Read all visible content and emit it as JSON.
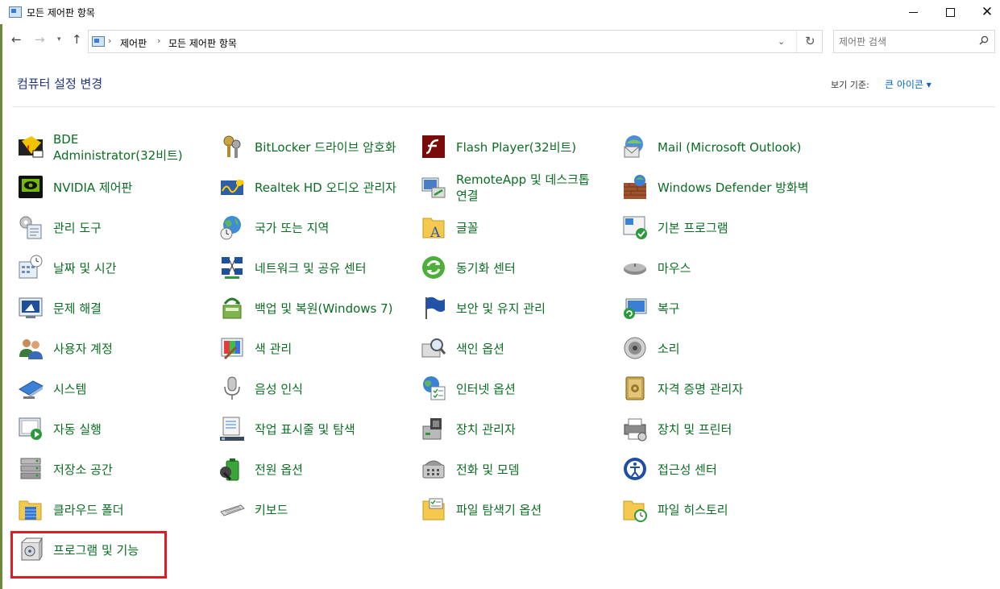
{
  "window": {
    "title": "모든 제어판 항목",
    "icon": "control-panel-icon"
  },
  "nav": {
    "back_icon": "back-arrow-icon",
    "forward_icon": "forward-arrow-icon",
    "recent_icon": "chevron-down-icon",
    "up_icon": "up-arrow-icon"
  },
  "address": {
    "breadcrumbs": [
      "제어판",
      "모든 제어판 항목"
    ]
  },
  "search": {
    "placeholder": "제어판 검색"
  },
  "header": {
    "title": "컴퓨터 설정 변경",
    "view_by_label": "보기 기준:",
    "view_by_value": "큰 아이콘 ▾"
  },
  "items": [
    {
      "label": "BDE Administrator(32비트)",
      "icon": "bde-admin-icon"
    },
    {
      "label": "BitLocker 드라이브 암호화",
      "icon": "bitlocker-icon"
    },
    {
      "label": "Flash Player(32비트)",
      "icon": "flash-player-icon"
    },
    {
      "label": "Mail (Microsoft Outlook)",
      "icon": "mail-icon"
    },
    {
      "label": "NVIDIA 제어판",
      "icon": "nvidia-icon"
    },
    {
      "label": "Realtek HD 오디오 관리자",
      "icon": "realtek-audio-icon"
    },
    {
      "label": "RemoteApp 및 데스크톱 연결",
      "icon": "remoteapp-icon"
    },
    {
      "label": "Windows Defender 방화벽",
      "icon": "firewall-icon"
    },
    {
      "label": "관리 도구",
      "icon": "admin-tools-icon"
    },
    {
      "label": "국가 또는 지역",
      "icon": "region-globe-icon"
    },
    {
      "label": "글꼴",
      "icon": "fonts-folder-icon"
    },
    {
      "label": "기본 프로그램",
      "icon": "default-programs-icon"
    },
    {
      "label": "날짜 및 시간",
      "icon": "date-time-icon"
    },
    {
      "label": "네트워크 및 공유 센터",
      "icon": "network-icon"
    },
    {
      "label": "동기화 센터",
      "icon": "sync-center-icon"
    },
    {
      "label": "마우스",
      "icon": "mouse-icon"
    },
    {
      "label": "문제 해결",
      "icon": "troubleshoot-icon"
    },
    {
      "label": "백업 및 복원(Windows 7)",
      "icon": "backup-restore-icon"
    },
    {
      "label": "보안 및 유지 관리",
      "icon": "security-flag-icon"
    },
    {
      "label": "복구",
      "icon": "recovery-icon"
    },
    {
      "label": "사용자 계정",
      "icon": "user-accounts-icon"
    },
    {
      "label": "색 관리",
      "icon": "color-management-icon"
    },
    {
      "label": "색인 옵션",
      "icon": "indexing-icon"
    },
    {
      "label": "소리",
      "icon": "sound-speaker-icon"
    },
    {
      "label": "시스템",
      "icon": "system-monitor-icon"
    },
    {
      "label": "음성 인식",
      "icon": "microphone-icon"
    },
    {
      "label": "인터넷 옵션",
      "icon": "internet-options-icon"
    },
    {
      "label": "자격 증명 관리자",
      "icon": "credential-vault-icon"
    },
    {
      "label": "자동 실행",
      "icon": "autoplay-icon"
    },
    {
      "label": "작업 표시줄 및 탐색",
      "icon": "taskbar-icon"
    },
    {
      "label": "장치 관리자",
      "icon": "device-manager-icon"
    },
    {
      "label": "장치 및 프린터",
      "icon": "printer-icon"
    },
    {
      "label": "저장소 공간",
      "icon": "storage-spaces-icon"
    },
    {
      "label": "전원 옵션",
      "icon": "power-battery-icon"
    },
    {
      "label": "전화 및 모뎀",
      "icon": "phone-modem-icon"
    },
    {
      "label": "접근성 센터",
      "icon": "accessibility-icon"
    },
    {
      "label": "클라우드 폴더",
      "icon": "cloud-folder-icon"
    },
    {
      "label": "키보드",
      "icon": "keyboard-icon"
    },
    {
      "label": "파일 탐색기 옵션",
      "icon": "explorer-options-icon"
    },
    {
      "label": "파일 히스토리",
      "icon": "file-history-icon"
    },
    {
      "label": "프로그램 및 기능",
      "icon": "programs-features-icon"
    }
  ],
  "colors": {
    "item_text": "#0a6e22",
    "heading": "#1e3287",
    "link": "#0066cc",
    "highlight_border": "#e01b24"
  }
}
